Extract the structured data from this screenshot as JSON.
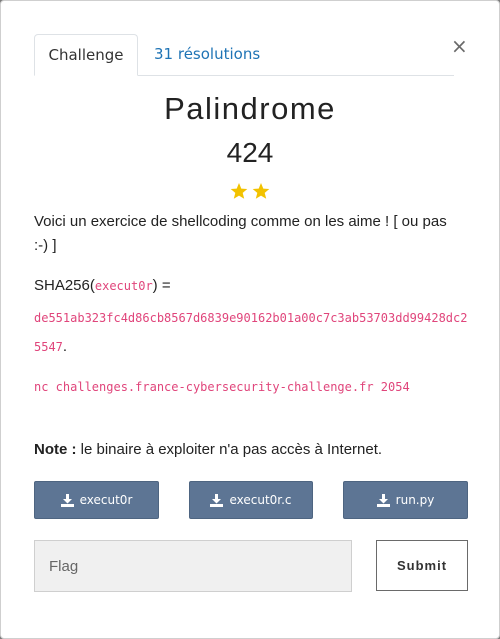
{
  "tabs": {
    "challenge": "Challenge",
    "solves": "31 résolutions"
  },
  "close_glyph": "×",
  "challenge": {
    "name": "Palindrome",
    "points": "424",
    "difficulty_stars": 2,
    "star_color": "#f2c200",
    "description": "Voici un exercice de shellcoding comme on les aime ! [ ou pas :-) ]",
    "sha_prefix": "SHA256(",
    "sha_file": "execut0r",
    "sha_suffix": ") =",
    "sha_hash": "de551ab323fc4d86cb8567d6839e90162b01a00c7c3ab53703dd99428dc25547",
    "sha_period": ".",
    "nc_command": "nc challenges.france-cybersecurity-challenge.fr 2054",
    "note_label": "Note :",
    "note_text": " le binaire à exploiter n'a pas accès à Internet."
  },
  "downloads": [
    {
      "label": "execut0r",
      "icon": "download-icon"
    },
    {
      "label": "execut0r.c",
      "icon": "download-icon"
    },
    {
      "label": "run.py",
      "icon": "download-icon"
    }
  ],
  "flag_form": {
    "placeholder": "Flag",
    "submit_label": "Submit"
  },
  "colors": {
    "accent": "#1f74b5",
    "download_button": "#5d7594",
    "code": "#e0457b"
  }
}
